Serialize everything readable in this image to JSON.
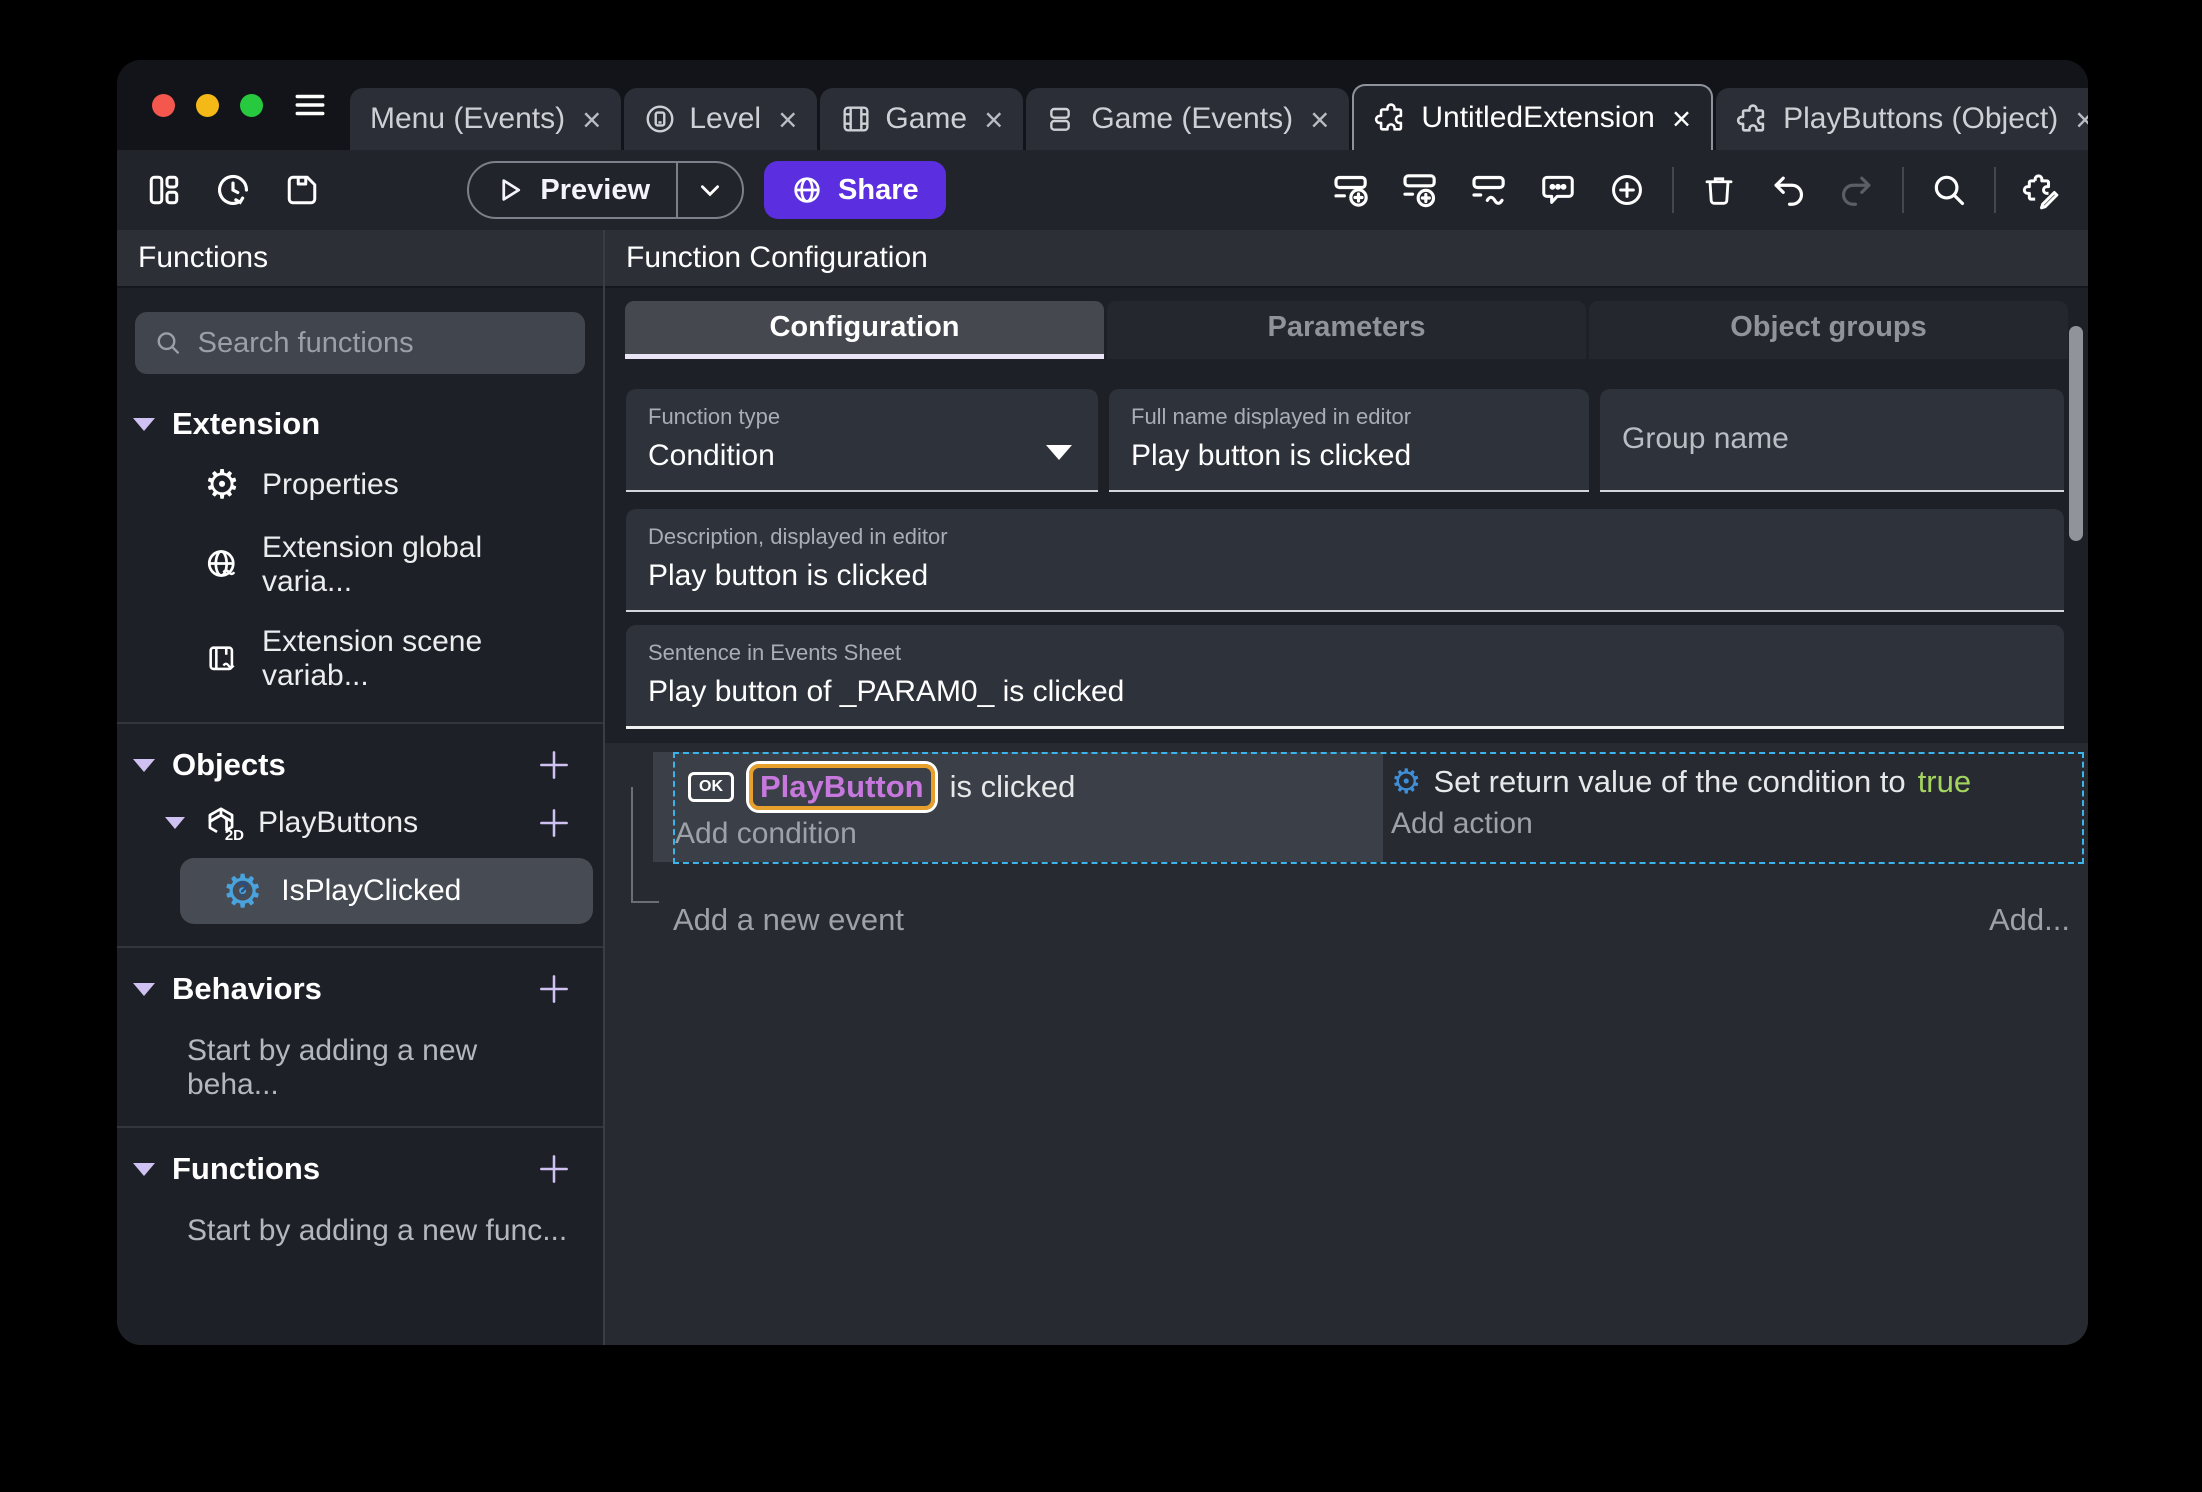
{
  "ui": {
    "close_glyph": "×",
    "object_2d_badge": "2D",
    "question_mark": "?"
  },
  "window_tabs": [
    {
      "label": "Menu (Events)",
      "icon": "none",
      "active": false
    },
    {
      "label": "Level",
      "icon": "device",
      "active": false
    },
    {
      "label": "Game",
      "icon": "film",
      "active": false
    },
    {
      "label": "Game (Events)",
      "icon": "events-sheet",
      "active": false
    },
    {
      "label": "UntitledExtension",
      "icon": "puzzle",
      "active": true
    },
    {
      "label": "PlayButtons (Object)",
      "icon": "puzzle",
      "active": false
    }
  ],
  "toolbar": {
    "preview_label": "Preview",
    "share_label": "Share"
  },
  "sidebar": {
    "title": "Functions",
    "search_placeholder": "Search functions",
    "sections": [
      {
        "label": "Extension",
        "items": [
          "Properties",
          "Extension global varia...",
          "Extension scene variab..."
        ]
      },
      {
        "label": "Objects",
        "object": "PlayButtons",
        "function": "IsPlayClicked"
      },
      {
        "label": "Behaviors",
        "empty": "Start by adding a new beha..."
      },
      {
        "label": "Functions",
        "empty": "Start by adding a new func..."
      }
    ]
  },
  "main": {
    "title": "Function Configuration",
    "tabs": [
      {
        "label": "Configuration",
        "active": true
      },
      {
        "label": "Parameters",
        "active": false
      },
      {
        "label": "Object groups",
        "active": false
      }
    ],
    "fields": {
      "function_type": {
        "label": "Function type",
        "value": "Condition"
      },
      "full_name": {
        "label": "Full name displayed in editor",
        "value": "Play button is clicked"
      },
      "group_name": {
        "placeholder": "Group name"
      },
      "description": {
        "label": "Description, displayed in editor",
        "value": "Play button is clicked"
      },
      "sentence": {
        "label": "Sentence in Events Sheet",
        "value": "Play button of _PARAM0_ is clicked"
      }
    }
  },
  "events": {
    "condition": {
      "ok_badge": "OK",
      "object": "PlayButton",
      "suffix": "is clicked",
      "add": "Add condition"
    },
    "action": {
      "prefix": "Set return value of the condition to",
      "value": "true",
      "add": "Add action"
    },
    "add_new_event": "Add a new event",
    "add_more": "Add..."
  },
  "colors": {
    "accent_purple": "#5b2fdf",
    "selection_blue": "#3ab4ea",
    "param_highlight_orange": "#e8a02c",
    "object_name_purple": "#c678dd",
    "boolean_true_green": "#a3d45f",
    "function_icon_blue": "#4aa3dc"
  }
}
